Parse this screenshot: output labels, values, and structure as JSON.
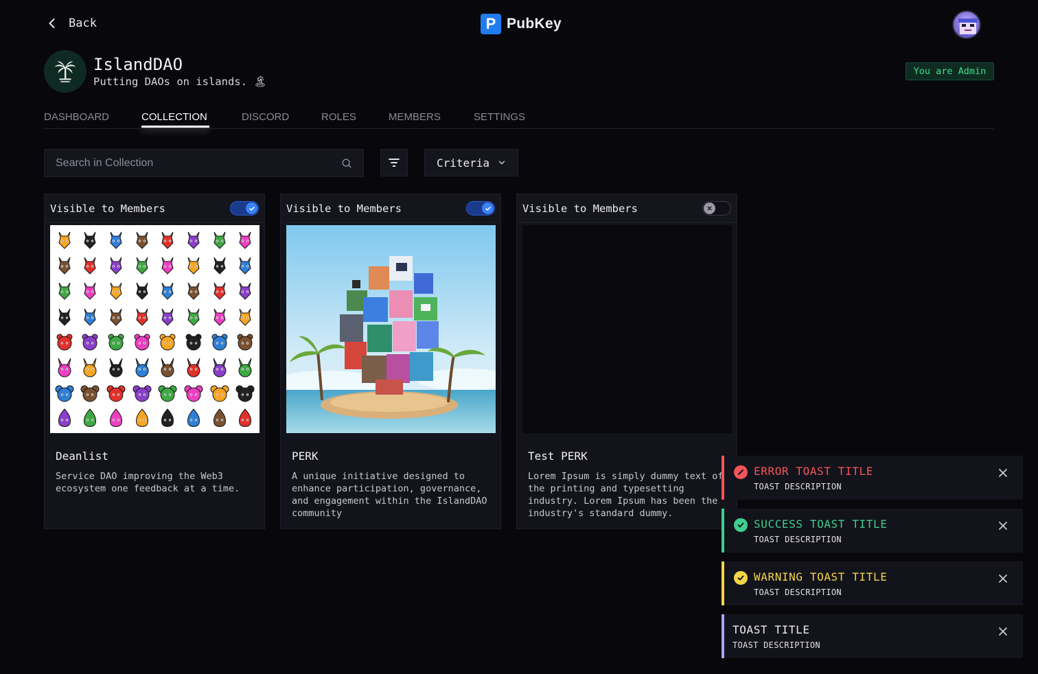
{
  "header": {
    "back_label": "Back",
    "brand_letter": "P",
    "brand_name": "PubKey",
    "avatar_icon": "user-avatar-icon"
  },
  "dao": {
    "name": "IslandDAO",
    "description": "Putting DAOs on islands. 🏝",
    "admin_badge": "You are Admin",
    "logo_icon": "palm-tree-icon"
  },
  "tabs": [
    {
      "label": "DASHBOARD",
      "active": false
    },
    {
      "label": "COLLECTION",
      "active": true
    },
    {
      "label": "DISCORD",
      "active": false
    },
    {
      "label": "ROLES",
      "active": false
    },
    {
      "label": "MEMBERS",
      "active": false
    },
    {
      "label": "SETTINGS",
      "active": false
    }
  ],
  "toolbar": {
    "search_placeholder": "Search in Collection",
    "search_icon": "search-icon",
    "filter_icon": "filter-icon",
    "criteria_label": "Criteria"
  },
  "cards": [
    {
      "visibility_label": "Visible to Members",
      "visible": true,
      "title": "Deanlist",
      "description": "Service DAO improving the Web3 ecosystem one feedback at a time."
    },
    {
      "visibility_label": "Visible to Members",
      "visible": true,
      "title": "PERK",
      "description": "A unique initiative designed to enhance participation, governance, and engagement within the IslandDAO community"
    },
    {
      "visibility_label": "Visible to Members",
      "visible": false,
      "title": "Test PERK",
      "description": "Lorem Ipsum is simply dummy text of the printing and typesetting industry. Lorem Ipsum has been the industry's standard dummy."
    }
  ],
  "toasts": [
    {
      "type": "error",
      "title": "ERROR TOAST TITLE",
      "description": "TOAST DESCRIPTION",
      "color": "#f2545b"
    },
    {
      "type": "success",
      "title": "SUCCESS TOAST TITLE",
      "description": "TOAST DESCRIPTION",
      "color": "#3ecf8e"
    },
    {
      "type": "warning",
      "title": "WARNING TOAST TITLE",
      "description": "TOAST DESCRIPTION",
      "color": "#f5d547"
    },
    {
      "type": "default",
      "title": "TOAST TITLE",
      "description": "TOAST DESCRIPTION",
      "color": "#a9a6ff"
    }
  ],
  "colors": {
    "background": "#08080c",
    "accent": "#1f7cf0",
    "admin": "#3fdd8f"
  }
}
